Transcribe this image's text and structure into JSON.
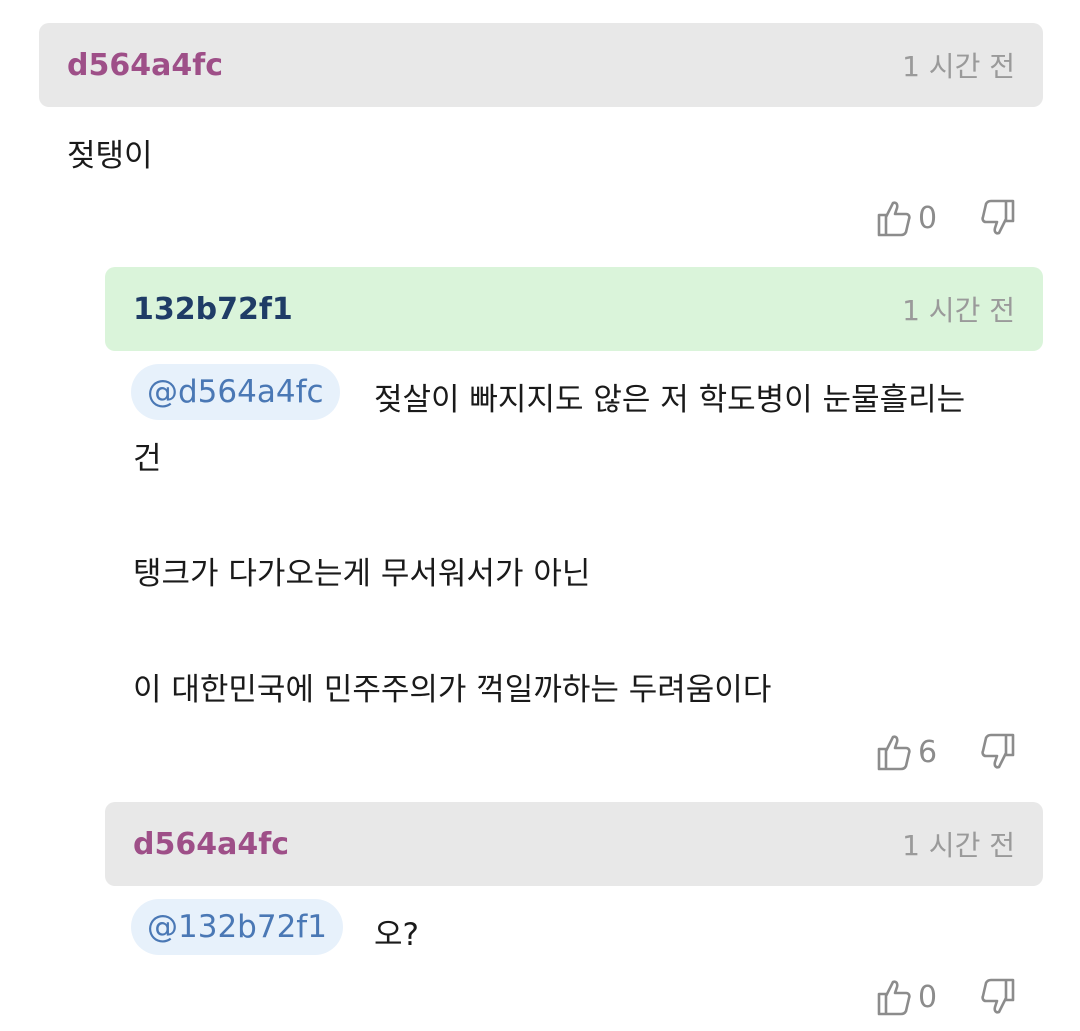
{
  "comments": [
    {
      "author": "d564a4fc",
      "time": "1 시간 전",
      "body": "젖탱이",
      "likes": "0"
    },
    {
      "author": "132b72f1",
      "time": "1 시간 전",
      "mention": "@d564a4fc",
      "body_line1": "젖살이 빠지지도 않은 저 학도병이 눈물흘리는",
      "body_line2": "건",
      "body_line3": "탱크가 다가오는게 무서워서가 아닌",
      "body_line4": "이 대한민국에 민주주의가 꺽일까하는 두려움이다",
      "likes": "6"
    },
    {
      "author": "d564a4fc",
      "time": "1 시간 전",
      "mention": "@132b72f1",
      "body": "오?",
      "likes": "0"
    }
  ],
  "icons": {
    "like": "thumbs-up-icon",
    "dislike": "thumbs-down-icon"
  },
  "colors": {
    "header_gray": "#e8e8e8",
    "header_green": "#daf4da",
    "author_pink": "#9e4f88",
    "author_navy": "#1f3c66",
    "mention_bg": "#e7f1fb",
    "mention_text": "#4a78b5"
  }
}
